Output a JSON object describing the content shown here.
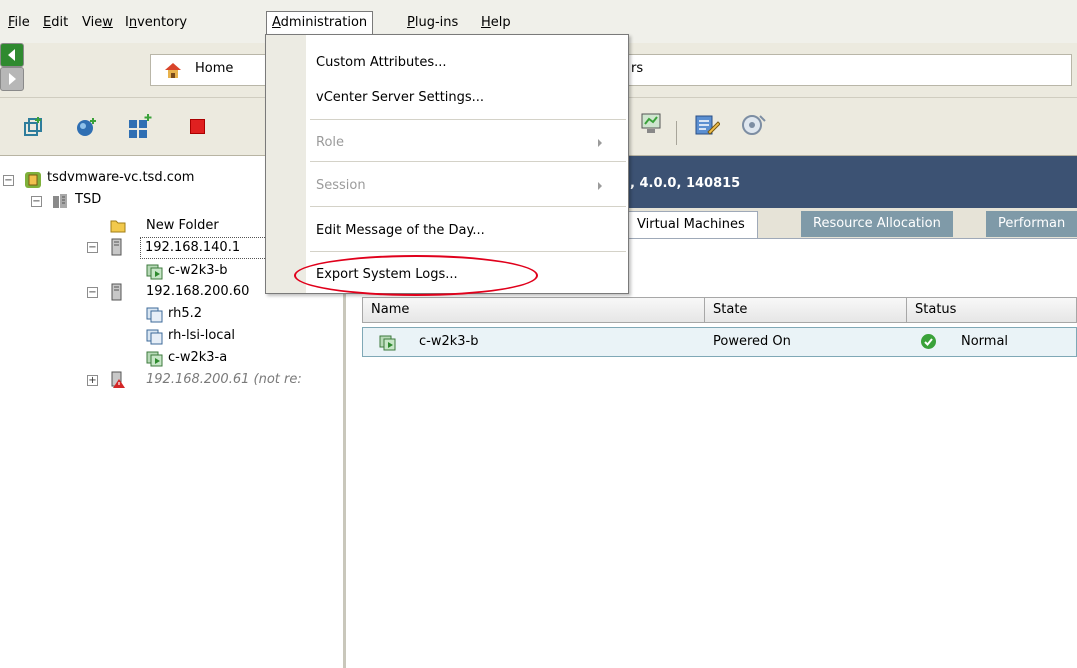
{
  "menubar": {
    "items": [
      {
        "label": "File",
        "key": "F"
      },
      {
        "label": "Edit",
        "key": "E"
      },
      {
        "label": "View",
        "key": "w"
      },
      {
        "label": "Inventory",
        "key": "n"
      },
      {
        "label": "Administration",
        "key": "A"
      },
      {
        "label": "Plug-ins",
        "key": "P"
      },
      {
        "label": "Help",
        "key": "H"
      }
    ]
  },
  "nav": {
    "home_label": "Home",
    "breadcrumb_fragment": "rs"
  },
  "admin_menu": {
    "items": [
      {
        "label": "Custom Attributes...",
        "enabled": true
      },
      {
        "label": "vCenter Server Settings...",
        "enabled": true
      },
      {
        "label": "Role",
        "enabled": false,
        "submenu": true
      },
      {
        "label": "Session",
        "enabled": false,
        "submenu": true
      },
      {
        "label": "Edit Message of the Day...",
        "enabled": true
      },
      {
        "label": "Export System Logs...",
        "enabled": true,
        "highlighted": true
      }
    ]
  },
  "tree": {
    "nodes": [
      {
        "label": "tsdvmware-vc.tsd.com"
      },
      {
        "label": "TSD"
      },
      {
        "label": "New Folder"
      },
      {
        "label": "192.168.140.1"
      },
      {
        "label": "c-w2k3-b"
      },
      {
        "label": "192.168.200.60"
      },
      {
        "label": "rh5.2"
      },
      {
        "label": "rh-lsi-local"
      },
      {
        "label": "c-w2k3-a"
      },
      {
        "label": "192.168.200.61 (not re:"
      }
    ]
  },
  "summary": {
    "title_fragment": ", 4.0.0, 140815"
  },
  "tabs": [
    {
      "label": "Virtual Machines",
      "active": true
    },
    {
      "label": "Resource Allocation",
      "active": false
    },
    {
      "label": "Performan",
      "active": false
    }
  ],
  "vm_table": {
    "headers": [
      "Name",
      "State",
      "Status"
    ],
    "rows": [
      {
        "name": "c-w2k3-b",
        "state": "Powered On",
        "status": "Normal"
      }
    ]
  },
  "colors": {
    "summary_bar": "#3c5273",
    "highlight_oval": "#e0001b",
    "status_normal": "#3aa23a"
  }
}
